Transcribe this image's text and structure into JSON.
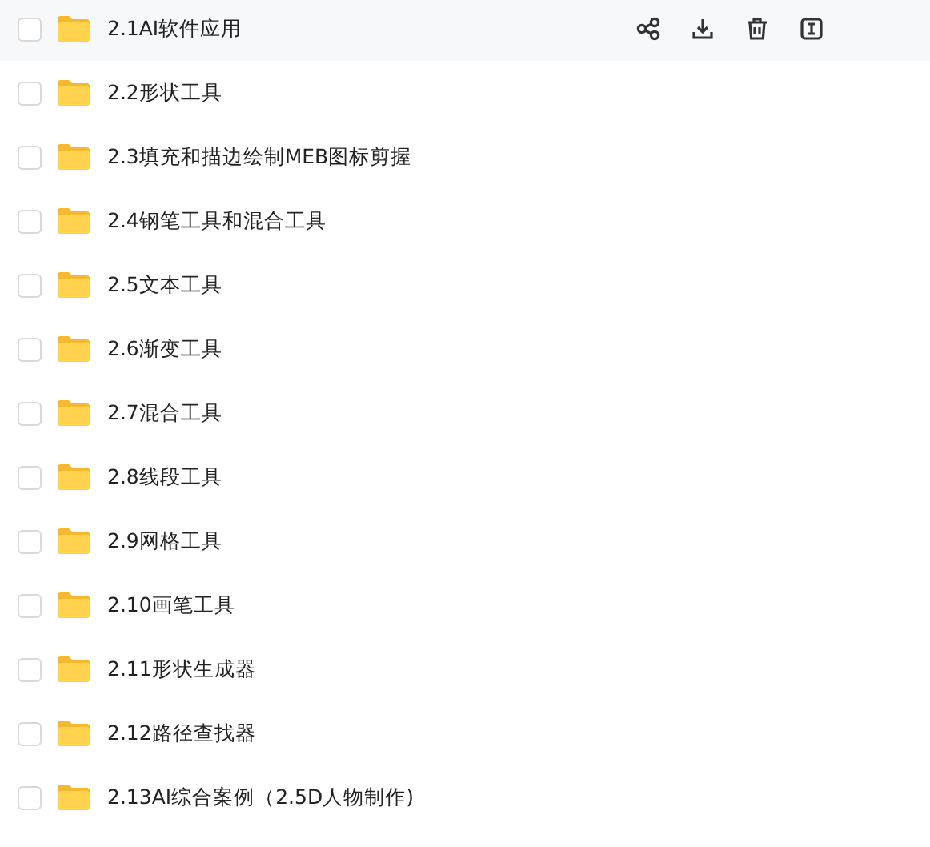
{
  "files": [
    {
      "name": "2.1AI软件应用",
      "checked": false,
      "hovered": true
    },
    {
      "name": "2.2形状工具",
      "checked": false,
      "hovered": false
    },
    {
      "name": "2.3填充和描边绘制MEB图标剪握",
      "checked": false,
      "hovered": false
    },
    {
      "name": "2.4钢笔工具和混合工具",
      "checked": false,
      "hovered": false
    },
    {
      "name": "2.5文本工具",
      "checked": false,
      "hovered": false
    },
    {
      "name": "2.6渐变工具",
      "checked": false,
      "hovered": false
    },
    {
      "name": "2.7混合工具",
      "checked": false,
      "hovered": false
    },
    {
      "name": "2.8线段工具",
      "checked": false,
      "hovered": false
    },
    {
      "name": "2.9网格工具",
      "checked": false,
      "hovered": false
    },
    {
      "name": "2.10画笔工具",
      "checked": false,
      "hovered": false
    },
    {
      "name": "2.11形状生成器",
      "checked": false,
      "hovered": false
    },
    {
      "name": "2.12路径查找器",
      "checked": false,
      "hovered": false
    },
    {
      "name": "2.13AI综合案例（2.5D人物制作)",
      "checked": false,
      "hovered": false
    }
  ]
}
